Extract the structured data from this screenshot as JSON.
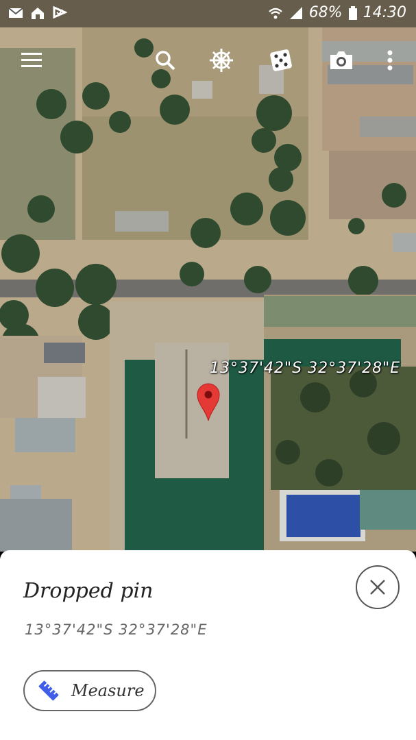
{
  "status_bar": {
    "battery_percent": "68%",
    "time": "14:30",
    "left_icons": [
      "mail-icon",
      "home-icon",
      "check-flag-icon"
    ],
    "right_icons": [
      "wifi-icon",
      "signal-icon",
      "battery-icon"
    ]
  },
  "toolbar": {
    "icons": [
      "menu-icon",
      "search-icon",
      "ship-wheel-icon",
      "dice-icon",
      "camera-icon",
      "more-vert-icon"
    ]
  },
  "map": {
    "coordinate_label": "13°37'42\"S 32°37'28\"E",
    "pin_color": "#e53935"
  },
  "place_sheet": {
    "title": "Dropped pin",
    "coordinates": "13°37'42\"S 32°37'28\"E",
    "close_icon": "close-icon",
    "measure_label": "Measure",
    "measure_icon": "ruler-icon"
  },
  "colors": {
    "measure_icon": "#3f5de8",
    "sheet_background": "#ffffff"
  }
}
